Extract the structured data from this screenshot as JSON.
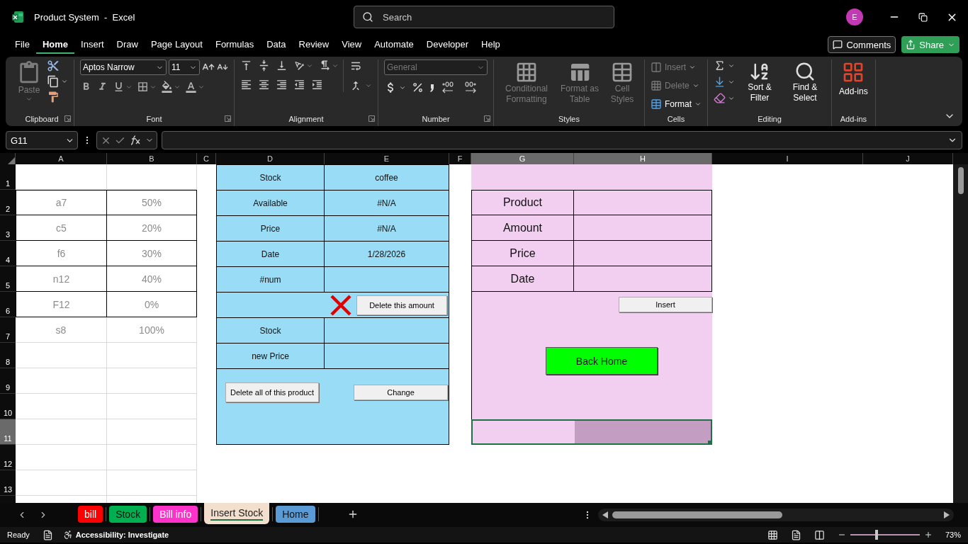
{
  "window": {
    "title": "Product System  -  Excel",
    "search_placeholder": "Search",
    "avatar": "E"
  },
  "menu_tabs": [
    {
      "label": "File",
      "selected": false
    },
    {
      "label": "Home",
      "selected": true
    },
    {
      "label": "Insert",
      "selected": false
    },
    {
      "label": "Draw",
      "selected": false
    },
    {
      "label": "Page Layout",
      "selected": false
    },
    {
      "label": "Formulas",
      "selected": false
    },
    {
      "label": "Data",
      "selected": false
    },
    {
      "label": "Review",
      "selected": false
    },
    {
      "label": "View",
      "selected": false
    },
    {
      "label": "Automate",
      "selected": false
    },
    {
      "label": "Developer",
      "selected": false
    },
    {
      "label": "Help",
      "selected": false
    }
  ],
  "comments_button": "Comments",
  "share_button": "Share",
  "ribbon": {
    "groups": [
      {
        "kind": "clipboard",
        "label": "Clipboard",
        "paste": {
          "label": "Paste",
          "disabled": true
        }
      },
      {
        "kind": "font",
        "label": "Font",
        "font_name": "Aptos Narrow",
        "font_size": "11"
      },
      {
        "kind": "alignment",
        "label": "Alignment"
      },
      {
        "kind": "number",
        "label": "Number",
        "format": {
          "value": "General",
          "disabled": true
        }
      },
      {
        "kind": "styles",
        "label": "Styles",
        "buttons": [
          {
            "label": "Conditional Formatting",
            "disabled": true
          },
          {
            "label": "Format as Table",
            "disabled": true
          },
          {
            "label": "Cell Styles",
            "disabled": true
          }
        ]
      },
      {
        "kind": "cells",
        "label": "Cells",
        "buttons": [
          {
            "label": "Insert",
            "disabled": true
          },
          {
            "label": "Delete",
            "disabled": true
          },
          {
            "label": "Format",
            "disabled": false
          }
        ]
      },
      {
        "kind": "editing",
        "label": "Editing",
        "buttons": [
          {
            "label": "Sort & Filter",
            "disabled": false
          },
          {
            "label": "Find & Select",
            "disabled": false
          }
        ]
      },
      {
        "kind": "addins",
        "label": "Add-ins",
        "buttons": [
          {
            "label": "Add-ins",
            "disabled": false
          }
        ]
      }
    ]
  },
  "formula_bar": {
    "name_box": "G11"
  },
  "columns": [
    {
      "label": "A",
      "selected": false
    },
    {
      "label": "B",
      "selected": false
    },
    {
      "label": "C",
      "selected": false
    },
    {
      "label": "D",
      "selected": false
    },
    {
      "label": "E",
      "selected": false
    },
    {
      "label": "F",
      "selected": false
    },
    {
      "label": "G",
      "selected": true
    },
    {
      "label": "H",
      "selected": true
    },
    {
      "label": "I",
      "selected": false
    },
    {
      "label": "J",
      "selected": false
    }
  ],
  "rows": [
    {
      "label": "1",
      "selected": false
    },
    {
      "label": "2",
      "selected": false
    },
    {
      "label": "3",
      "selected": false
    },
    {
      "label": "4",
      "selected": false
    },
    {
      "label": "5",
      "selected": false
    },
    {
      "label": "6",
      "selected": false
    },
    {
      "label": "7",
      "selected": false
    },
    {
      "label": "8",
      "selected": false
    },
    {
      "label": "9",
      "selected": false
    },
    {
      "label": "10",
      "selected": false
    },
    {
      "label": "11",
      "selected": true
    },
    {
      "label": "12",
      "selected": false
    },
    {
      "label": "13",
      "selected": false
    }
  ],
  "left_table": [
    {
      "code": "a7",
      "percent": "50%",
      "bordered": true
    },
    {
      "code": "c5",
      "percent": "20%",
      "bordered": true
    },
    {
      "code": "f6",
      "percent": "30%",
      "bordered": true
    },
    {
      "code": "n12",
      "percent": "40%",
      "bordered": true
    },
    {
      "code": "F12",
      "percent": "0%",
      "bordered": true
    },
    {
      "code": "s8",
      "percent": "100%",
      "bordered": false
    }
  ],
  "stock_panel": {
    "fields": [
      {
        "label": "Stock",
        "value": "coffee"
      },
      {
        "label": "Available",
        "value": "#N/A"
      },
      {
        "label": "Price",
        "value": "#N/A"
      },
      {
        "label": "Date",
        "value": "1/28/2026"
      },
      {
        "label": "#num"
      }
    ],
    "delete_amount_button": "Delete this amount",
    "edit_fields": [
      {
        "label": "Stock"
      },
      {
        "label": "new Price"
      }
    ],
    "delete_all_button": "Delete all of this product",
    "change_button": "Change"
  },
  "insert_panel": {
    "fields": [
      {
        "label": "Product"
      },
      {
        "label": "Amount"
      },
      {
        "label": "Price"
      },
      {
        "label": "Date"
      }
    ],
    "insert_button": "Insert",
    "back_home_button": "Back Home"
  },
  "sheet_tabs": [
    {
      "label": "bill",
      "color": "#ff0000",
      "selected": false
    },
    {
      "label": "Stock",
      "color": "#00b050",
      "selected": false
    },
    {
      "label": "Bill info",
      "color": "#ff33cc",
      "selected": false
    },
    {
      "label": "Insert Stock",
      "color": "#f3dfce",
      "selected": true
    },
    {
      "label": "Home",
      "color": "#5b9bd5",
      "selected": false
    }
  ],
  "status_bar": {
    "mode": "Ready",
    "accessibility": "Accessibility: Investigate",
    "zoom": "73%",
    "zoom_slider": {
      "level": 0.36
    }
  }
}
